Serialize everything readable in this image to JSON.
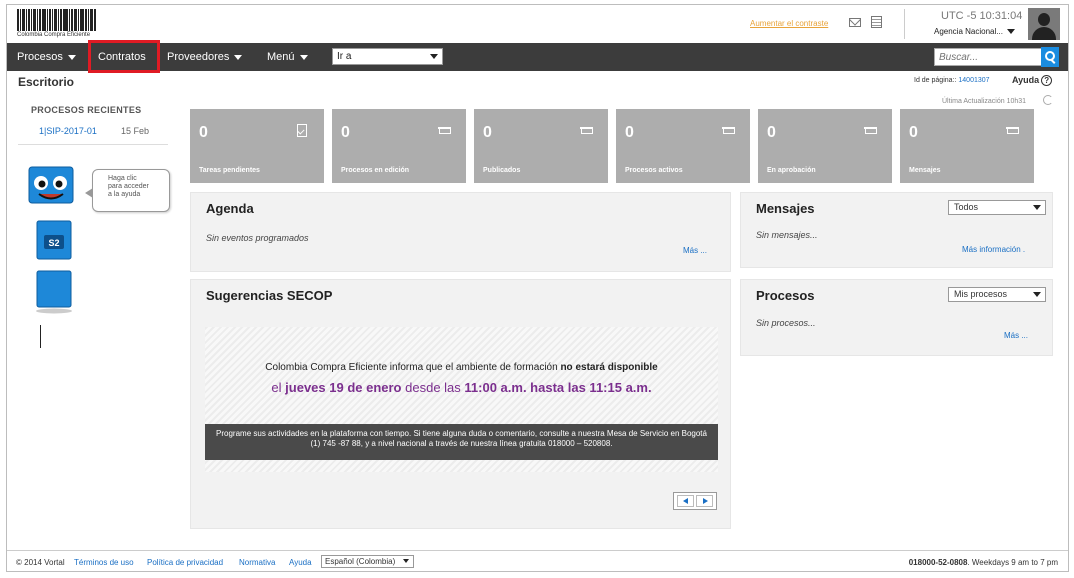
{
  "header": {
    "logo_text": "Colombia Compra Eficiente",
    "contrast_link": "Aumentar el contraste",
    "time": "UTC -5 10:31:04",
    "agency": "Agencia Nacional..."
  },
  "nav": {
    "items": [
      "Procesos",
      "Contratos",
      "Proveedores",
      "Menú"
    ],
    "goto_value": "Ir a",
    "search_placeholder": "Buscar..."
  },
  "page": {
    "title": "Escritorio",
    "id_label": "Id de página::",
    "id_value": "14001307",
    "help": "Ayuda",
    "help_icon_glyph": "?",
    "last_update": "Última Actualización 10h31"
  },
  "recent": {
    "title": "PROCESOS RECIENTES",
    "items": [
      {
        "code": "1|SIP-2017-01",
        "date": "15 Feb"
      }
    ]
  },
  "mascot": {
    "bubble_lines": [
      "Haga clic",
      "para acceder",
      "a la ayuda"
    ],
    "badge": "S2"
  },
  "tiles": [
    {
      "count": "0",
      "label": "Tareas pendientes",
      "icon": "clipboard-icon"
    },
    {
      "count": "0",
      "label": "Procesos en edición",
      "icon": "cart-icon"
    },
    {
      "count": "0",
      "label": "Publicados",
      "icon": "cart-icon"
    },
    {
      "count": "0",
      "label": "Procesos activos",
      "icon": "cart-icon"
    },
    {
      "count": "0",
      "label": "En aprobación",
      "icon": "cart-icon"
    },
    {
      "count": "0",
      "label": "Mensajes",
      "icon": "cart-icon"
    }
  ],
  "agenda": {
    "title": "Agenda",
    "empty": "Sin eventos programados",
    "more": "Más ..."
  },
  "mensajes": {
    "title": "Mensajes",
    "filter": "Todos",
    "empty": "Sin mensajes...",
    "more": "Más información ."
  },
  "procesos": {
    "title": "Procesos",
    "filter": "Mis procesos",
    "empty": "Sin procesos...",
    "more": "Más ..."
  },
  "sugerencias": {
    "title": "Sugerencias SECOP",
    "line1_a": "Colombia Compra Eficiente informa que el ambiente de formación",
    "line1_b": "no estará disponible",
    "line2_a": "el",
    "line2_b": "jueves 19 de enero",
    "line2_c": "desde las",
    "line2_d": "11:00 a.m. hasta las 11:15 a.m.",
    "bar_text": "Programe sus actividades en la plataforma con tiempo. Si tiene alguna duda o comentario, consulte a nuestra Mesa de Servicio en Bogotá (1) 745 -87 88, y a nivel nacional a través de nuestra línea gratuita 018000 – 520808."
  },
  "footer": {
    "copyright": "© 2014 Vortal",
    "links": [
      "Términos de uso",
      "Política de privacidad",
      "Normativa",
      "Ayuda"
    ],
    "language": "Español (Colombia)",
    "phone": "018000-52-0808",
    "hours": ". Weekdays 9 am to 7 pm"
  },
  "colors": {
    "nav_bg": "#3c3c3c",
    "tile_bg": "#adadad",
    "highlight": "#e01b24",
    "link": "#1a6fc4",
    "accent_purple": "#7b2f8e"
  }
}
